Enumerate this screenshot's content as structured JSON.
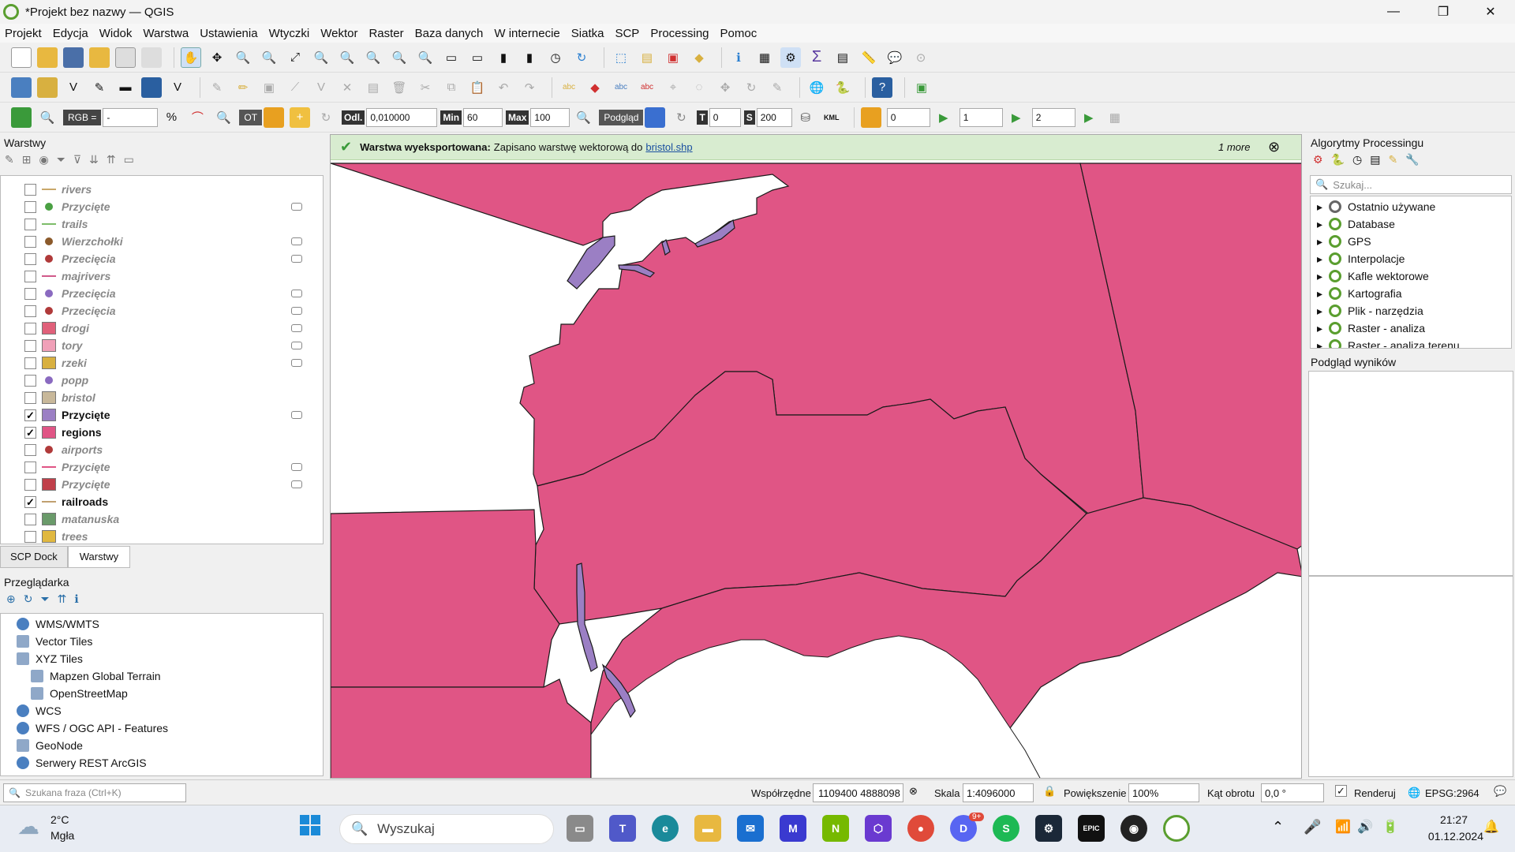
{
  "window": {
    "title": "*Projekt bez nazwy — QGIS"
  },
  "menu": [
    "Projekt",
    "Edycja",
    "Widok",
    "Warstwa",
    "Ustawienia",
    "Wtyczki",
    "Wektor",
    "Raster",
    "Baza danych",
    "W internecie",
    "Siatka",
    "SCP",
    "Processing",
    "Pomoc"
  ],
  "scp_toolbar": {
    "rgb_label": "RGB =",
    "rgb_value": "-",
    "ot_label": "OT",
    "dist_label": "Odl.",
    "dist_value": "0,010000",
    "min_label": "Min",
    "min_value": "60",
    "max_label": "Max",
    "max_value": "100",
    "preview_label": "Podgląd",
    "t_label": "T",
    "t_value": "0",
    "s_label": "S",
    "s_value": "200",
    "kml_label": "KML",
    "band1": "0",
    "band2": "1",
    "band3": "2"
  },
  "layers_panel": {
    "title": "Warstwy",
    "tabs": [
      "SCP Dock",
      "Warstwy"
    ],
    "items": [
      {
        "name": "rivers",
        "checked": false,
        "symbol": "line",
        "color": "#c9a86a",
        "filter": false
      },
      {
        "name": "Przycięte",
        "checked": false,
        "symbol": "dot",
        "color": "#4aa043",
        "filter": true
      },
      {
        "name": "trails",
        "checked": false,
        "symbol": "line",
        "color": "#7dbd6a",
        "filter": false
      },
      {
        "name": "Wierzchołki",
        "checked": false,
        "symbol": "dot",
        "color": "#8b5a2b",
        "filter": true
      },
      {
        "name": "Przecięcia",
        "checked": false,
        "symbol": "dot",
        "color": "#b03a3a",
        "filter": true
      },
      {
        "name": "majrivers",
        "checked": false,
        "symbol": "line",
        "color": "#d05a8a",
        "filter": false
      },
      {
        "name": "Przecięcia",
        "checked": false,
        "symbol": "dot",
        "color": "#8a6ac0",
        "filter": true
      },
      {
        "name": "Przecięcia",
        "checked": false,
        "symbol": "dot",
        "color": "#b03a3a",
        "filter": true
      },
      {
        "name": "drogi",
        "checked": false,
        "symbol": "fill",
        "color": "#e0607a",
        "filter": true
      },
      {
        "name": "tory",
        "checked": false,
        "symbol": "fill",
        "color": "#f0a0b8",
        "filter": true
      },
      {
        "name": "rzeki",
        "checked": false,
        "symbol": "fill",
        "color": "#d8b040",
        "filter": true
      },
      {
        "name": "popp",
        "checked": false,
        "symbol": "dot",
        "color": "#8a6ac0",
        "filter": false
      },
      {
        "name": "bristol",
        "checked": false,
        "symbol": "fill",
        "color": "#c8b89a",
        "filter": false
      },
      {
        "name": "Przycięte",
        "checked": true,
        "symbol": "fill",
        "color": "#9b7fc4",
        "filter": true
      },
      {
        "name": "regions",
        "checked": true,
        "symbol": "fill",
        "color": "#e05585",
        "filter": false
      },
      {
        "name": "airports",
        "checked": false,
        "symbol": "dot",
        "color": "#b03a3a",
        "filter": false
      },
      {
        "name": "Przycięte",
        "checked": false,
        "symbol": "line",
        "color": "#e05585",
        "filter": true
      },
      {
        "name": "Przycięte",
        "checked": false,
        "symbol": "fill",
        "color": "#c0404a",
        "filter": true
      },
      {
        "name": "railroads",
        "checked": true,
        "symbol": "line",
        "color": "#c0a070",
        "filter": false
      },
      {
        "name": "matanuska",
        "checked": false,
        "symbol": "fill",
        "color": "#6a9a6a",
        "filter": false
      },
      {
        "name": "trees",
        "checked": false,
        "symbol": "fill",
        "color": "#e0b840",
        "filter": false
      }
    ]
  },
  "browser_panel": {
    "title": "Przeglądarka",
    "items": [
      "WMS/WMTS",
      "Vector Tiles",
      "XYZ Tiles",
      "Mapzen Global Terrain",
      "OpenStreetMap",
      "WCS",
      "WFS / OGC API - Features",
      "GeoNode",
      "Serwery REST ArcGIS"
    ]
  },
  "message": {
    "bold": "Warstwa wyeksportowana:",
    "text": "Zapisano warstwę wektorową do",
    "link": "bristol.shp",
    "more": "1 more"
  },
  "processing_panel": {
    "title": "Algorytmy Processingu",
    "search_placeholder": "Szukaj...",
    "items": [
      "Ostatnio używane",
      "Database",
      "GPS",
      "Interpolacje",
      "Kafle wektorowe",
      "Kartografia",
      "Plik - narzędzia",
      "Raster - analiza",
      "Raster - analiza terenu"
    ]
  },
  "results_panel": {
    "title": "Podgląd wyników"
  },
  "statusbar": {
    "search_placeholder": "Szukana fraza (Ctrl+K)",
    "coord_label": "Współrzędne",
    "coord_value": "1109400 4888098",
    "scale_label": "Skala",
    "scale_value": "1:4096000",
    "zoom_label": "Powiększenie",
    "zoom_value": "100%",
    "rotation_label": "Kąt obrotu",
    "rotation_value": "0,0 °",
    "render_label": "Renderuj",
    "crs": "EPSG:2964"
  },
  "map": {
    "fill_color": "#e05585",
    "clip_color": "#9b7fc4",
    "background": "#ffffff"
  },
  "taskbar": {
    "temp": "2°C",
    "weather": "Mgła",
    "search": "Wyszukaj",
    "time": "21:27",
    "date": "01.12.2024",
    "discord_badge": "9+"
  }
}
